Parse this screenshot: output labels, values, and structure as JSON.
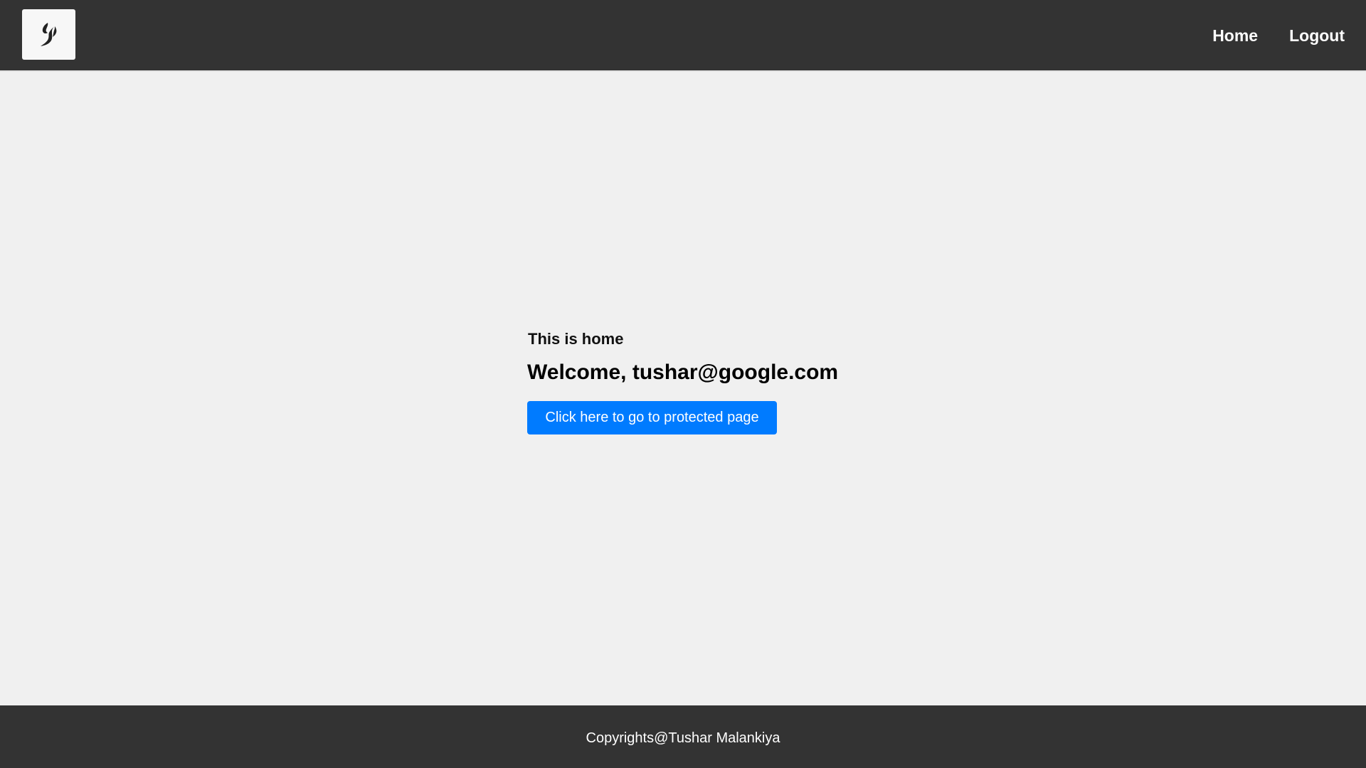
{
  "header": {
    "logo_icon": "flame-leaf-logo-icon",
    "nav": {
      "home_label": "Home",
      "logout_label": "Logout"
    }
  },
  "main": {
    "subtitle": "This is home",
    "welcome": "Welcome, tushar@google.com",
    "protected_button_label": "Click here to go to protected page"
  },
  "footer": {
    "copyright": "Copyrights@Tushar Malankiya"
  },
  "colors": {
    "header_bg": "#333333",
    "page_bg": "#f0f0f0",
    "button_bg": "#007bff"
  }
}
